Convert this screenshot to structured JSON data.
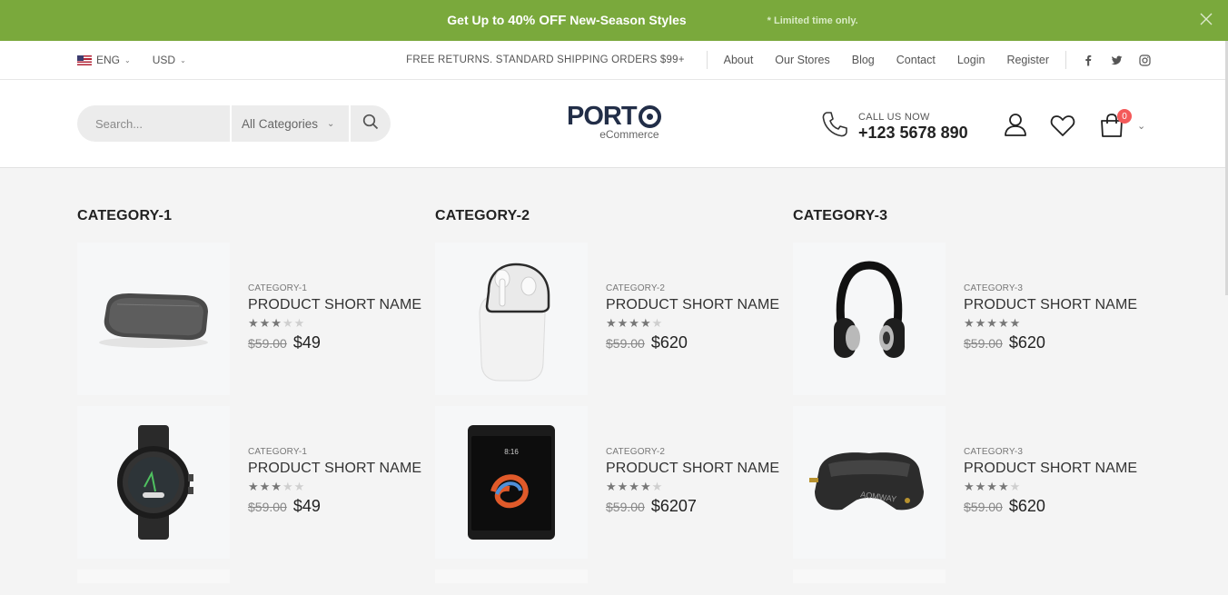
{
  "promo": {
    "prefix": "Get Up to ",
    "highlight": "40% OFF",
    "suffix": " New-Season Styles",
    "note": "* Limited time only."
  },
  "topbar": {
    "language": "ENG",
    "currency": "USD",
    "shipping": "FREE RETURNS. STANDARD SHIPPING ORDERS $99+",
    "links": [
      "About",
      "Our Stores",
      "Blog",
      "Contact",
      "Login",
      "Register"
    ]
  },
  "header": {
    "search_placeholder": "Search...",
    "category_select": "All Categories",
    "logo_text": "PORT",
    "logo_sub": "eCommerce",
    "call_label": "CALL US NOW",
    "call_number": "+123 5678 890",
    "cart_count": "0"
  },
  "columns": [
    {
      "title": "CATEGORY-1",
      "products": [
        {
          "category": "CATEGORY-1",
          "name": "PRODUCT SHORT NAME",
          "rating": 3,
          "old_price": "$59.00",
          "price": "$49",
          "image": "speaker"
        },
        {
          "category": "CATEGORY-1",
          "name": "PRODUCT SHORT NAME",
          "rating": 3,
          "old_price": "$59.00",
          "price": "$49",
          "image": "watch"
        }
      ]
    },
    {
      "title": "CATEGORY-2",
      "products": [
        {
          "category": "CATEGORY-2",
          "name": "PRODUCT SHORT NAME",
          "rating": 4,
          "old_price": "$59.00",
          "price": "$620",
          "image": "earbuds"
        },
        {
          "category": "CATEGORY-2",
          "name": "PRODUCT SHORT NAME",
          "rating": 4,
          "old_price": "$59.00",
          "price": "$6207",
          "image": "phone"
        }
      ]
    },
    {
      "title": "CATEGORY-3",
      "products": [
        {
          "category": "CATEGORY-3",
          "name": "PRODUCT SHORT NAME",
          "rating": 5,
          "old_price": "$59.00",
          "price": "$620",
          "image": "headphones"
        },
        {
          "category": "CATEGORY-3",
          "name": "PRODUCT SHORT NAME",
          "rating": 4,
          "old_price": "$59.00",
          "price": "$620",
          "image": "vr-goggles"
        }
      ]
    }
  ],
  "colors": {
    "promo_bg": "#7aa93c",
    "badge": "#f45a5a"
  }
}
